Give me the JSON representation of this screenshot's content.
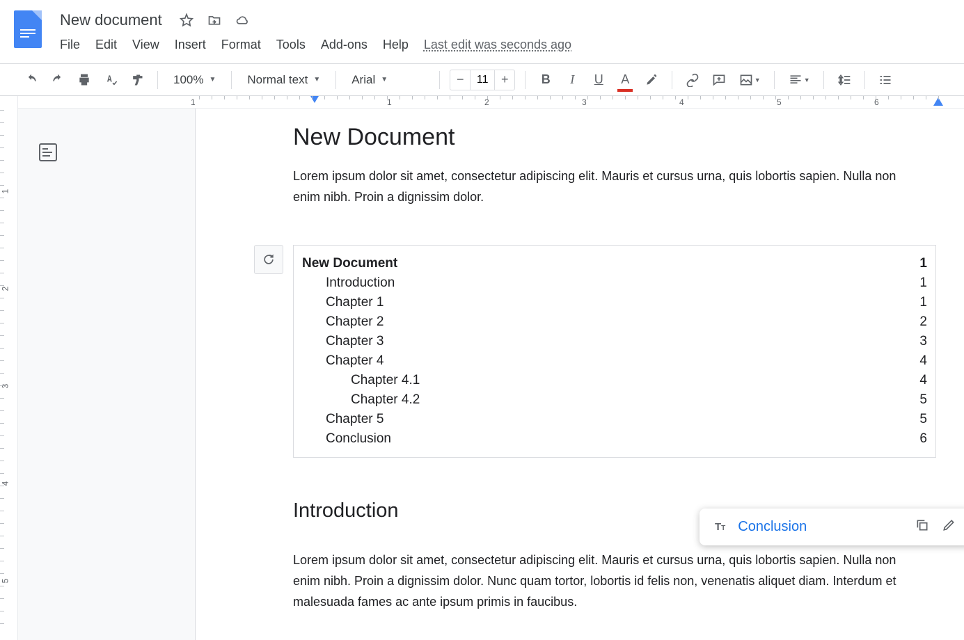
{
  "header": {
    "title": "New document",
    "menus": [
      "File",
      "Edit",
      "View",
      "Insert",
      "Format",
      "Tools",
      "Add-ons",
      "Help"
    ],
    "last_edit": "Last edit was seconds ago"
  },
  "toolbar": {
    "zoom": "100%",
    "style": "Normal text",
    "font": "Arial",
    "font_size": "11"
  },
  "ruler_h_numbers": [
    1,
    1,
    2,
    3,
    4,
    5,
    6
  ],
  "ruler_v_numbers": [
    1,
    2,
    3,
    4,
    5
  ],
  "document": {
    "heading": "New Document",
    "intro_text": "Lorem ipsum dolor sit amet, consectetur adipiscing elit. Mauris et cursus urna, quis lobortis sapien. Nulla non enim nibh. Proin a dignissim dolor.",
    "toc": [
      {
        "label": "New Document",
        "page": "1",
        "level": 0
      },
      {
        "label": "Introduction",
        "page": "1",
        "level": 1
      },
      {
        "label": "Chapter 1",
        "page": "1",
        "level": 1
      },
      {
        "label": "Chapter 2",
        "page": "2",
        "level": 1
      },
      {
        "label": "Chapter 3",
        "page": "3",
        "level": 1
      },
      {
        "label": "Chapter 4",
        "page": "4",
        "level": 1
      },
      {
        "label": "Chapter 4.1",
        "page": "4",
        "level": 2
      },
      {
        "label": "Chapter 4.2",
        "page": "5",
        "level": 2
      },
      {
        "label": "Chapter 5",
        "page": "5",
        "level": 1
      },
      {
        "label": "Conclusion",
        "page": "6",
        "level": 1
      }
    ],
    "section_heading": "Introduction",
    "section_text": "Lorem ipsum dolor sit amet, consectetur adipiscing elit. Mauris et cursus urna, quis lobortis sapien. Nulla non enim nibh. Proin a dignissim dolor. Nunc quam tortor, lobortis id felis non, venenatis aliquet diam. Interdum et malesuada fames ac ante ipsum primis in faucibus."
  },
  "popup": {
    "link_text": "Conclusion"
  }
}
